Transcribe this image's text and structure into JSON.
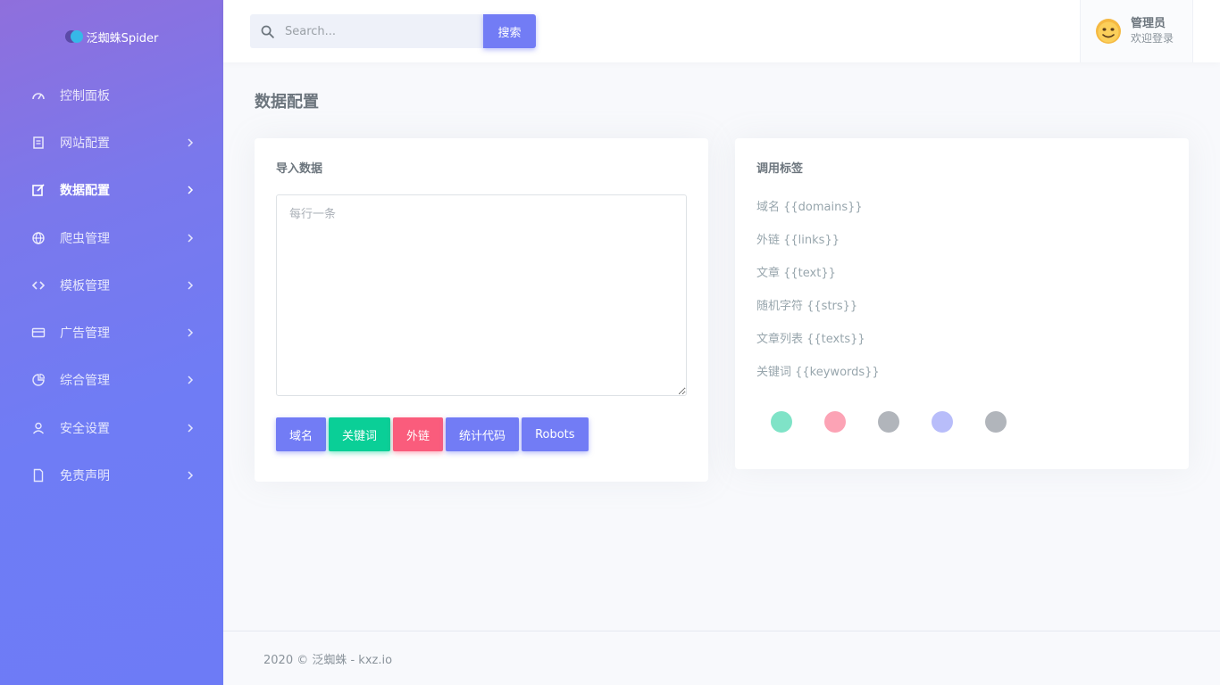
{
  "brand": {
    "name": "泛蜘蛛Spider"
  },
  "sidebar": {
    "items": [
      {
        "label": "控制面板",
        "icon": "gauge-icon",
        "has_arrow": false,
        "active": false
      },
      {
        "label": "网站配置",
        "icon": "document-icon",
        "has_arrow": true,
        "active": false
      },
      {
        "label": "数据配置",
        "icon": "edit-icon",
        "has_arrow": true,
        "active": true
      },
      {
        "label": "爬虫管理",
        "icon": "globe-icon",
        "has_arrow": true,
        "active": false
      },
      {
        "label": "模板管理",
        "icon": "code-icon",
        "has_arrow": true,
        "active": false
      },
      {
        "label": "广告管理",
        "icon": "card-icon",
        "has_arrow": true,
        "active": false
      },
      {
        "label": "综合管理",
        "icon": "pie-chart-icon",
        "has_arrow": true,
        "active": false
      },
      {
        "label": "安全设置",
        "icon": "user-icon",
        "has_arrow": true,
        "active": false
      },
      {
        "label": "免责声明",
        "icon": "file-icon",
        "has_arrow": true,
        "active": false
      }
    ]
  },
  "header": {
    "search_placeholder": "Search...",
    "search_button": "搜索",
    "user": {
      "name": "管理员",
      "subtitle": "欢迎登录"
    }
  },
  "main": {
    "page_title": "数据配置",
    "import_card": {
      "title": "导入数据",
      "textarea_placeholder": "每行一条",
      "textarea_value": "",
      "buttons": [
        {
          "label": "域名",
          "style": "primary"
        },
        {
          "label": "关键词",
          "style": "success"
        },
        {
          "label": "外链",
          "style": "danger"
        },
        {
          "label": "统计代码",
          "style": "primary"
        },
        {
          "label": "Robots",
          "style": "primary"
        }
      ]
    },
    "tags_card": {
      "title": "调用标签",
      "tags": [
        "域名 {{domains}}",
        "外链 {{links}}",
        "文章 {{text}}",
        "随机字符 {{strs}}",
        "文章列表 {{texts}}",
        "关键词 {{keywords}}"
      ],
      "dot_colors": [
        "#7fe3c7",
        "#fca3b5",
        "#b1b5bb",
        "#b8bdfa",
        "#b1b5bb"
      ]
    }
  },
  "footer": {
    "text": "2020 © 泛蜘蛛 - kxz.io"
  },
  "colors": {
    "primary": "#727cf5",
    "success": "#0acf97",
    "danger": "#fa5c7c"
  }
}
